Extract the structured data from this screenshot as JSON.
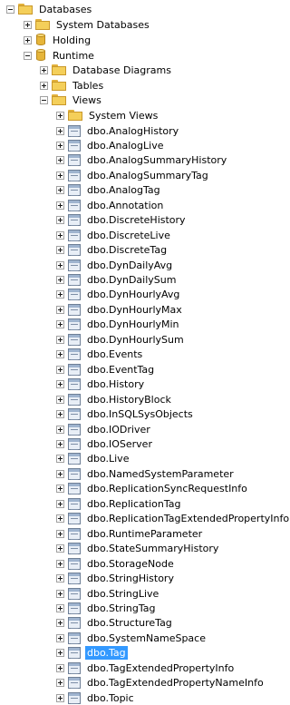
{
  "tree": {
    "root": "Databases",
    "system_databases": "System Databases",
    "holding": "Holding",
    "runtime": "Runtime",
    "database_diagrams": "Database Diagrams",
    "tables": "Tables",
    "views": "Views",
    "system_views": "System Views",
    "selected_view": "dbo.Tag",
    "view_items": [
      "dbo.AnalogHistory",
      "dbo.AnalogLive",
      "dbo.AnalogSummaryHistory",
      "dbo.AnalogSummaryTag",
      "dbo.AnalogTag",
      "dbo.Annotation",
      "dbo.DiscreteHistory",
      "dbo.DiscreteLive",
      "dbo.DiscreteTag",
      "dbo.DynDailyAvg",
      "dbo.DynDailySum",
      "dbo.DynHourlyAvg",
      "dbo.DynHourlyMax",
      "dbo.DynHourlyMin",
      "dbo.DynHourlySum",
      "dbo.Events",
      "dbo.EventTag",
      "dbo.History",
      "dbo.HistoryBlock",
      "dbo.InSQLSysObjects",
      "dbo.IODriver",
      "dbo.IOServer",
      "dbo.Live",
      "dbo.NamedSystemParameter",
      "dbo.ReplicationSyncRequestInfo",
      "dbo.ReplicationTag",
      "dbo.ReplicationTagExtendedPropertyInfo",
      "dbo.RuntimeParameter",
      "dbo.StateSummaryHistory",
      "dbo.StorageNode",
      "dbo.StringHistory",
      "dbo.StringLive",
      "dbo.StringTag",
      "dbo.StructureTag",
      "dbo.SystemNameSpace",
      "dbo.Tag",
      "dbo.TagExtendedPropertyInfo",
      "dbo.TagExtendedPropertyNameInfo",
      "dbo.Topic"
    ]
  },
  "icons": {
    "folder": "folder-icon",
    "database": "database-icon",
    "view": "view-icon"
  },
  "colors": {
    "selection": "#3399ff",
    "folder": "#f4cf5a"
  }
}
